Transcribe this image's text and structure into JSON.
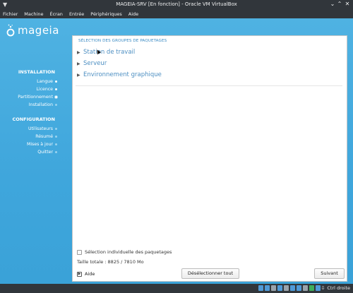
{
  "window": {
    "title": "MAGEIA-SRV [En fonction] - Oracle VM VirtualBox",
    "icon": "virtualbox-app-icon",
    "controls": {
      "minimize": "⌄",
      "maximize": "⌃",
      "close": "✕"
    }
  },
  "menu": [
    "Fichier",
    "Machine",
    "Écran",
    "Entrée",
    "Périphériques",
    "Aide"
  ],
  "logo": {
    "text": "mageia"
  },
  "sidebar": {
    "installation": {
      "heading": "INSTALLATION",
      "items": [
        {
          "label": "Langue",
          "state": "done"
        },
        {
          "label": "Licence",
          "state": "done"
        },
        {
          "label": "Partitionnement",
          "state": "current"
        },
        {
          "label": "Installation",
          "state": "todo"
        }
      ]
    },
    "configuration": {
      "heading": "CONFIGURATION",
      "items": [
        {
          "label": "Utilisateurs",
          "state": "todo"
        },
        {
          "label": "Résumé",
          "state": "todo"
        },
        {
          "label": "Mises à jour",
          "state": "todo"
        },
        {
          "label": "Quitter",
          "state": "todo"
        }
      ]
    }
  },
  "panel": {
    "heading": "SÉLECTION DES GROUPES DE PAQUETAGES",
    "groups": [
      "Station de travail",
      "Serveur",
      "Environnement graphique"
    ],
    "individual_checkbox": {
      "label": "Sélection individuelle des paquetages",
      "checked": false
    },
    "total_size": "Taille totale : 8825 / 7810 Mo",
    "buttons": {
      "help": "Aide",
      "deselect": "Désélectionner tout",
      "next": "Suivant"
    }
  },
  "statusbar": {
    "host_key": "Ctrl droite"
  },
  "colors": {
    "accent": "#3b8bc4",
    "sidebar_bg": "#41a8dd",
    "chrome": "#31363b"
  }
}
